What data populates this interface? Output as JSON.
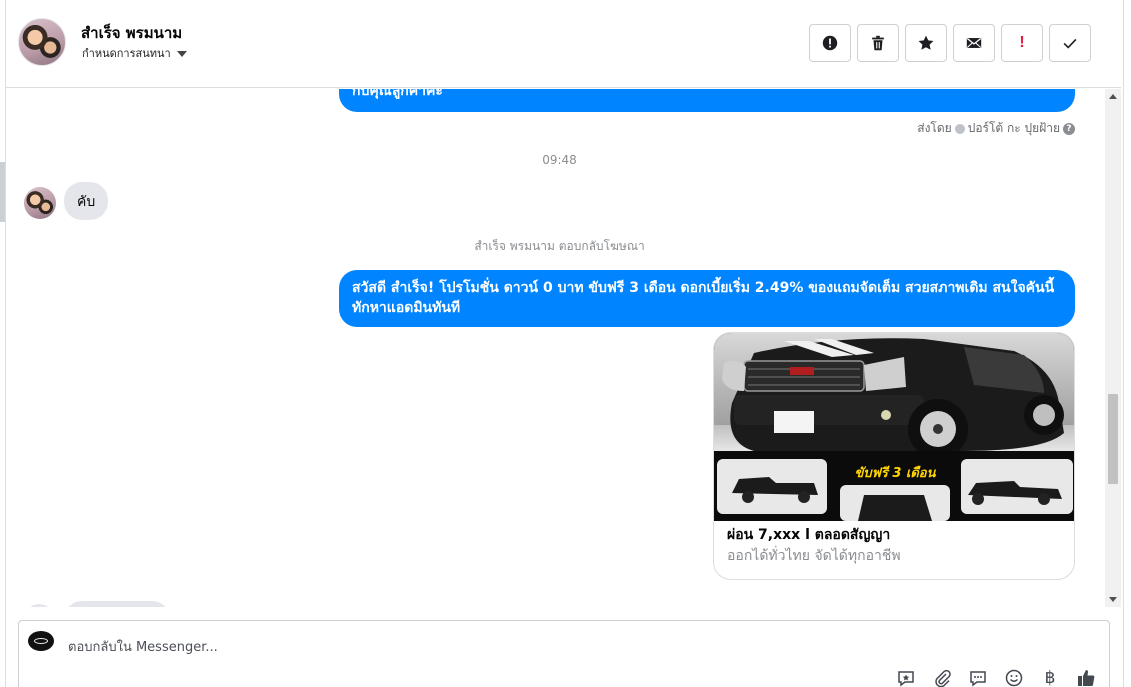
{
  "header": {
    "contact_name": "สำเร็จ พรมนาม",
    "assign_label": "กำหนดการสนทนา",
    "toolbar": [
      {
        "name": "mark-spam-button",
        "icon": "alert-circle-icon"
      },
      {
        "name": "delete-button",
        "icon": "trash-icon"
      },
      {
        "name": "star-button",
        "icon": "star-icon"
      },
      {
        "name": "mark-unread-button",
        "icon": "envelope-icon"
      },
      {
        "name": "mark-important-button",
        "icon": "exclamation-icon",
        "glyph": "!"
      },
      {
        "name": "mark-done-button",
        "icon": "check-icon"
      }
    ]
  },
  "conversation": {
    "message_1_tail": "กับคุณลูกค้าคะ",
    "sent_by_label": "ส่งโดย",
    "sent_by_name": "ปอร์โต้ กะ ปุยฝ้าย",
    "timestamp": "09:48",
    "incoming_message": "คับ",
    "ad_reply_notice": "สำเร็จ พรมนาม ตอบกลับโฆษณา",
    "message_2": "สวัสดี สำเร็จ! โปรโมชั่น ดาวน์ 0 บาท ขับฟรี 3 เดือน ดอกเบี้ยเริ่ม 2.49% ของแถมจัดเต็ม สวยสภาพเดิม สนใจคันนี้ทักหาแอดมินทันที",
    "ad_card": {
      "image_banner_text": "ขับฟรี 3 เดือน",
      "title": "ผ่อน 7,xxx l ตลอดสัญญา",
      "subtitle": "ออกได้ทั่วไทย จัดได้ทุกอาชีพ"
    }
  },
  "composer": {
    "placeholder": "ตอบกลับใน Messenger...",
    "tools": [
      "saved-reply-icon",
      "attachment-icon",
      "chat-bubble-icon",
      "emoji-icon",
      "baht-icon",
      "thumbs-up-icon"
    ]
  },
  "colors": {
    "accent": "#0084ff",
    "incoming_bubble": "#e4e6eb",
    "important": "#e41e3f"
  }
}
